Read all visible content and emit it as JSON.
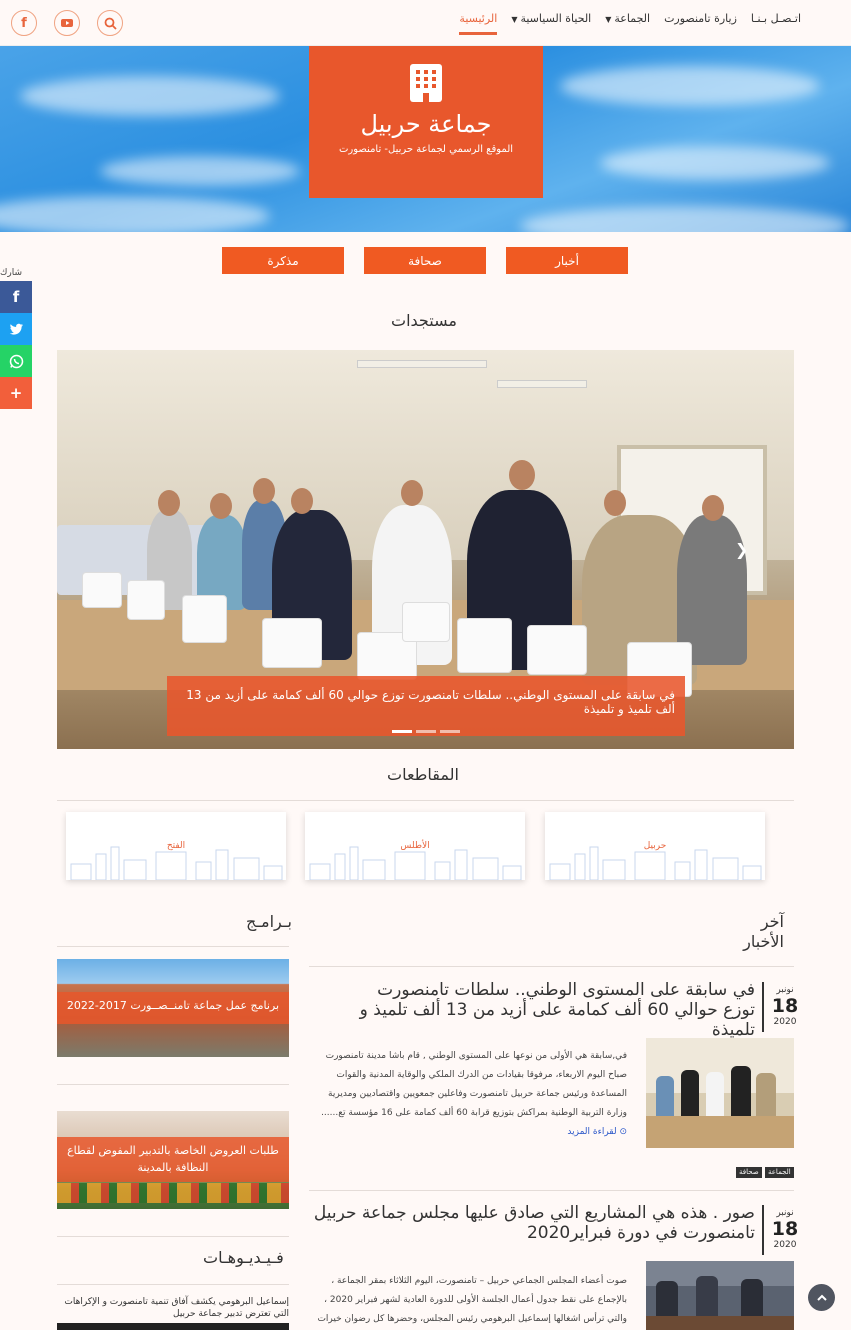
{
  "nav": {
    "items": [
      "الرئيسية",
      "الحياة السياسية",
      "الجماعة",
      "زيارة تامنصورت",
      "اتـصـل بـنـا"
    ],
    "social": [
      "facebook-icon",
      "youtube-icon",
      "search-icon"
    ]
  },
  "hero": {
    "title": "جماعة حربيل",
    "subtitle": "الموقع الرسمي لجماعة حربيل- تامنصورت"
  },
  "share": {
    "label": "شارك",
    "buttons": [
      "facebook-icon",
      "twitter-icon",
      "whatsapp-icon",
      "plus-icon"
    ]
  },
  "categories": [
    "أخبار",
    "صحافة",
    "مذكرة"
  ],
  "sections": {
    "latest_updates": "مستجدات",
    "districts": "المقاطعات",
    "latest_news": "آخر الأخبار",
    "programs": "بـرامـج",
    "videos": "فـيـديـوهـات"
  },
  "slider": {
    "caption": "في سابقة على المستوى الوطني.. سلطات تامنصورت توزع حوالي 60 ألف كمامة على أزيد من 13 ألف تلميذ و تلميذة"
  },
  "districts": [
    "حربيل",
    "الأطلس",
    "الفتح"
  ],
  "programs": [
    {
      "caption": "برنامج عمل جماعة تامنــصــورت 2017-2022"
    },
    {
      "caption": "طلبات العروض الخاصة بالتدبير المفوض لقطاع النظافة بالمدينة"
    }
  ],
  "news": [
    {
      "month": "نونبر",
      "day": "18",
      "year": "2020",
      "title": "في سابقة على المستوى الوطني.. سلطات تامنصورت توزع حوالي 60 ألف كمامة على أزيد من 13 ألف تلميذ و تلميذة",
      "excerpt": "في,سابقة هي الأولى من نوعها على المستوى الوطني , قام باشا مدينة تامنصورت صباح اليوم الاربعاء، مرفوقا بقيادات من الدرك الملكي والوقاية المدنية والقوات المساعدة ورئيس جماعة حربيل تامنصورت وفاعلين جمعويين واقتصاديين ومديرية وزارة التربية الوطنية بمراكش بتوزيع قرابة 60 ألف كمامة على 16 مؤسسة تع......",
      "read_more": "لقراءة المزيد",
      "tags": [
        "الجماعة",
        "صحافة"
      ]
    },
    {
      "month": "نونبر",
      "day": "18",
      "year": "2020",
      "title": "صور . هذه هي المشاريع التي صادق عليها مجلس جماعة حربيل تامنصورت في دورة فبراير2020",
      "excerpt": "صوت أعضاء المجلس الجماعي حربيل – تامنصورت، اليوم الثلاثاء بمقر الجماعة ، بالإجماع على نقط جدول أعمال الجلسة الأولى للدورة العادية لشهر فبراير 2020 ، والتي ترأس اشغالها إسماعيل البرهومي رئيس المجلس، وحضرها كل رضوان خيرات المدير الجهوي لوزارة الشباب والرياضة، والمدير الاقليمي للصحة بمرا......"
    }
  ],
  "videos": [
    {
      "title": "إسماعيل البرهومي يكشف آفاق تنمية تامنصورت و الإكراهات التي تعترض تدبير جماعة حربيل"
    }
  ],
  "colors": {
    "accent": "#e8572c",
    "button": "#f05a22",
    "sky": "#2b8fe0"
  }
}
